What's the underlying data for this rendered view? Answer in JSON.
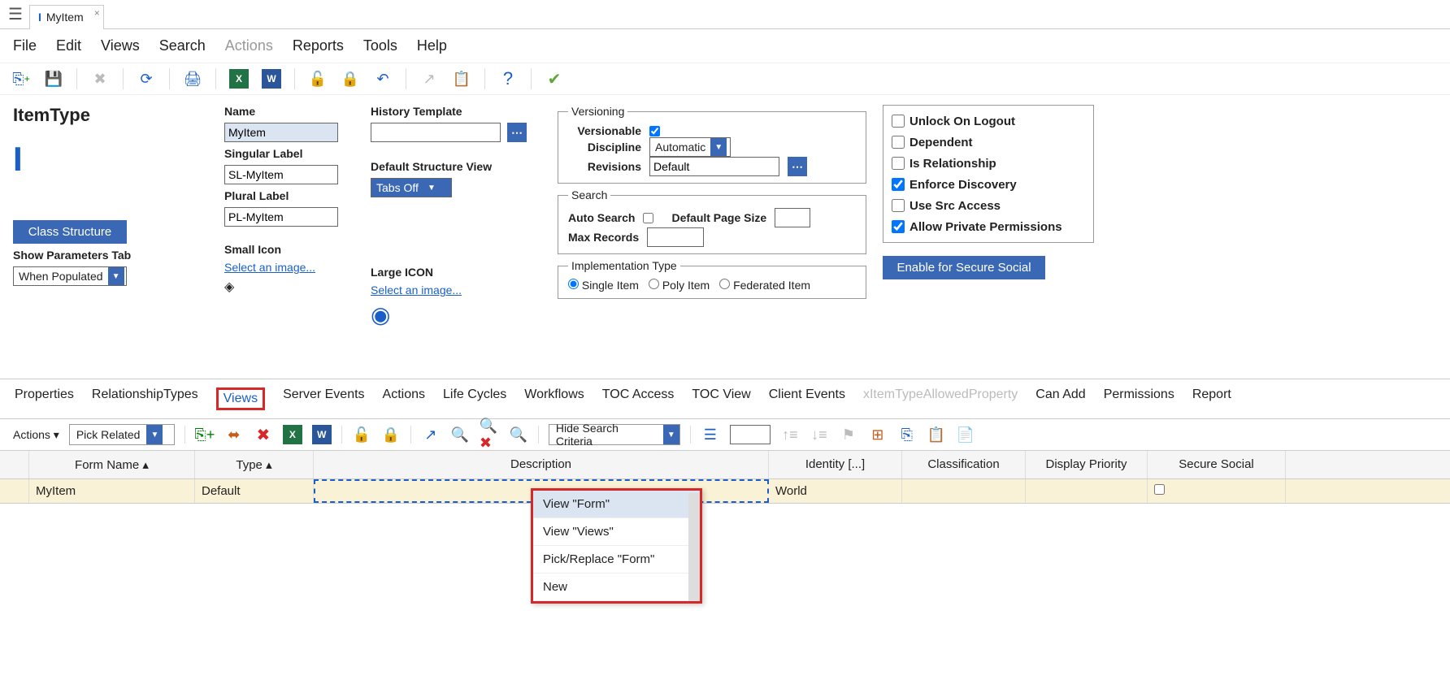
{
  "tab": {
    "title": "MyItem"
  },
  "menu": {
    "file": "File",
    "edit": "Edit",
    "views": "Views",
    "search": "Search",
    "actions": "Actions",
    "reports": "Reports",
    "tools": "Tools",
    "help": "Help"
  },
  "page": {
    "title": "ItemType"
  },
  "fields": {
    "name_label": "Name",
    "name_value": "MyItem",
    "singular_label": "Singular Label",
    "singular_value": "SL-MyItem",
    "plural_label": "Plural Label",
    "plural_value": "PL-MyItem",
    "small_icon_label": "Small Icon",
    "large_icon_label": "Large ICON",
    "select_image": "Select an image...",
    "history_label": "History Template",
    "default_struct_label": "Default Structure View",
    "default_struct_value": "Tabs Off",
    "class_structure": "Class Structure",
    "show_params_label": "Show Parameters Tab",
    "show_params_value": "When Populated"
  },
  "versioning": {
    "legend": "Versioning",
    "versionable": "Versionable",
    "discipline_label": "Discipline",
    "discipline_value": "Automatic",
    "revisions_label": "Revisions",
    "revisions_value": "Default"
  },
  "search": {
    "legend": "Search",
    "auto_search": "Auto Search",
    "default_page_size": "Default Page Size",
    "max_records": "Max Records"
  },
  "impl": {
    "legend": "Implementation Type",
    "single": "Single Item",
    "poly": "Poly Item",
    "federated": "Federated Item"
  },
  "checks": {
    "unlock": "Unlock On Logout",
    "dependent": "Dependent",
    "is_rel": "Is Relationship",
    "enforce": "Enforce Discovery",
    "use_src": "Use Src Access",
    "allow_priv": "Allow Private Permissions"
  },
  "enable_social": "Enable for Secure Social",
  "subtabs": {
    "properties": "Properties",
    "reltypes": "RelationshipTypes",
    "views": "Views",
    "server_events": "Server Events",
    "actions": "Actions",
    "life_cycles": "Life Cycles",
    "workflows": "Workflows",
    "toc_access": "TOC Access",
    "toc_view": "TOC View",
    "client_events": "Client Events",
    "xallowed": "xItemTypeAllowedProperty",
    "can_add": "Can Add",
    "permissions": "Permissions",
    "reports": "Report"
  },
  "subtoolbar": {
    "actions": "Actions",
    "pick_related": "Pick Related",
    "hide_search": "Hide Search Criteria"
  },
  "grid": {
    "headers": {
      "form": "Form Name",
      "type": "Type",
      "desc": "Description",
      "identity": "Identity [...]",
      "class": "Classification",
      "prio": "Display Priority",
      "secure": "Secure Social"
    },
    "row": {
      "form": "MyItem",
      "type": "Default",
      "identity": "World"
    }
  },
  "context": {
    "view_form": "View \"Form\"",
    "view_views": "View \"Views\"",
    "pick_replace": "Pick/Replace \"Form\"",
    "new": "New"
  }
}
